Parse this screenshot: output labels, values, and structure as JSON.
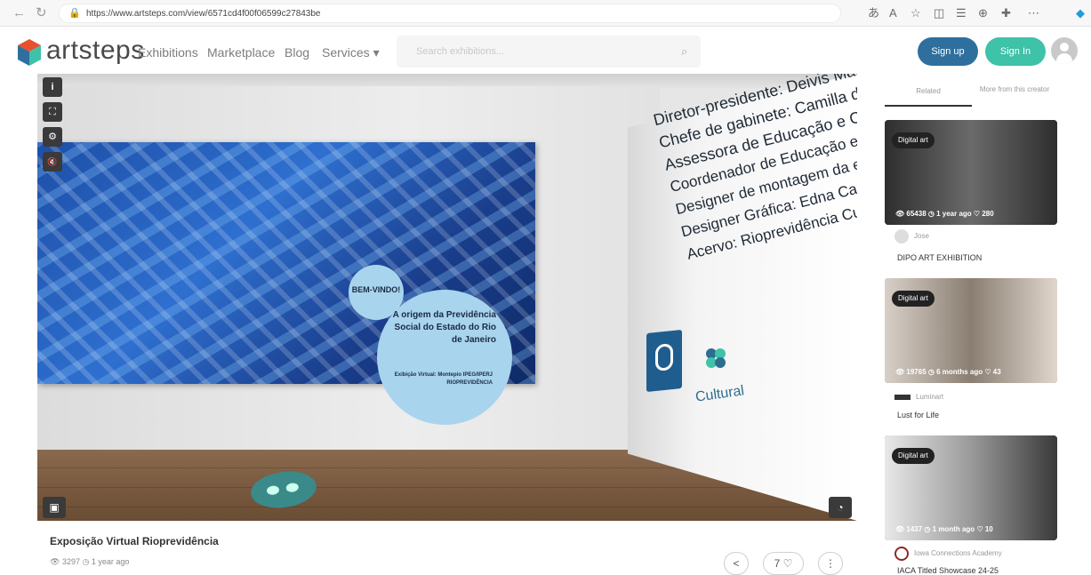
{
  "browser": {
    "url": "https://www.artsteps.com/view/6571cd4f00f06599c27843be",
    "icons": [
      "back-icon",
      "refresh-icon",
      "lock-icon",
      "reader-icon",
      "font-icon",
      "favorite-icon",
      "split-icon",
      "favorites-bar-icon",
      "collections-icon",
      "extensions-icon",
      "more-icon"
    ]
  },
  "header": {
    "logo": "artsteps",
    "nav": [
      "Exhibitions",
      "Marketplace",
      "Blog",
      "Services ▾"
    ],
    "search_placeholder": "Search exhibitions...",
    "signup_label": "Sign up",
    "signin_label": "Sign In"
  },
  "viewer": {
    "painting": {
      "welcome": "BEM-VINDO!",
      "heading": "A origem da Previdência Social do Estado do Rio de Janeiro",
      "sub": "Exibição Virtual: Montepio IPEG/IPERJ RIOPREVIDÊNCIA"
    },
    "credits": [
      "Diretor-presidente: Deivis Marco",
      "Chefe de gabinete: Camilla dos",
      "Assessora de Educação e Cultur",
      "Coordenador de Educação e Cu",
      "Designer de montagem da expo",
      "Designer Gráfica: Edna Carolina",
      "Acervo: Rioprevidência Cultural"
    ],
    "cultural_label": "Cultural",
    "controls": {
      "info": "i",
      "fullscreen": "⛶",
      "settings": "⚙",
      "mute": "🔇"
    }
  },
  "exhibition": {
    "title": "Exposição Virtual Rioprevidência",
    "views": "3297",
    "age": "1 year ago",
    "likes": "7"
  },
  "sidebar": {
    "tabs": [
      "Related",
      "More from this creator"
    ],
    "cards": [
      {
        "badge": "Digital art",
        "views": "65438",
        "age": "1 year ago",
        "likes": "280",
        "creator": "Jose",
        "title": "DIPO ART EXHIBITION"
      },
      {
        "badge": "Digital art",
        "views": "19765",
        "age": "6 months ago",
        "likes": "43",
        "creator": "Luminart",
        "title": "Lust for Life"
      },
      {
        "badge": "Digital art",
        "views": "1437",
        "age": "1 month ago",
        "likes": "10",
        "creator": "Iowa Connections Academy",
        "title": "IACA Titled Showcase 24-25"
      }
    ]
  }
}
